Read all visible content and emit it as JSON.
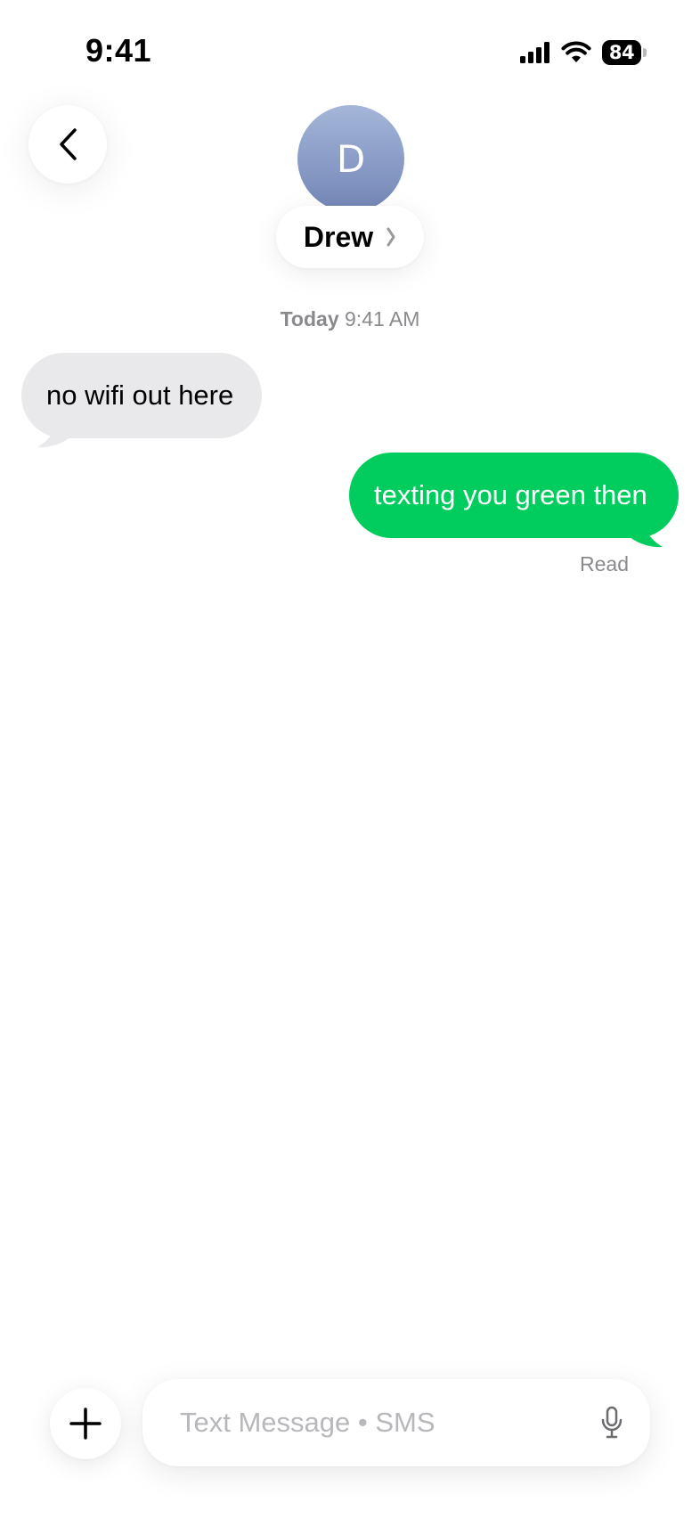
{
  "status_bar": {
    "time": "9:41",
    "battery_level": "84",
    "icons": [
      "signal-icon",
      "wifi-icon",
      "battery-icon"
    ]
  },
  "header": {
    "back_icon": "chevron-left-icon",
    "avatar_initial": "D",
    "contact_name": "Drew",
    "chevron_icon": "chevron-right-icon"
  },
  "conversation": {
    "timestamp_day": "Today",
    "timestamp_time": "9:41 AM",
    "messages": [
      {
        "direction": "incoming",
        "text": "no wifi out here"
      },
      {
        "direction": "outgoing",
        "text": "texting you green then"
      }
    ],
    "read_receipt": "Read"
  },
  "composer": {
    "plus_icon": "plus-icon",
    "placeholder": "Text Message • SMS",
    "value": "",
    "mic_icon": "microphone-icon"
  },
  "colors": {
    "outgoing_bubble": "#00cd5d",
    "incoming_bubble": "#e9e9eb",
    "secondary_text": "#8a8a8e",
    "avatar_top": "#a5b6d9",
    "avatar_bottom": "#7385b6"
  }
}
